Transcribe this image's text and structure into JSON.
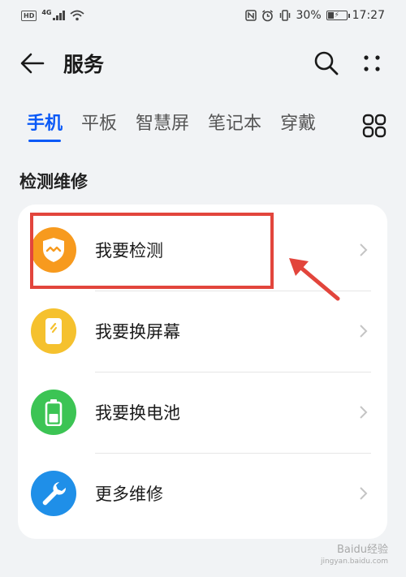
{
  "status_bar": {
    "left": {
      "hd": "HD",
      "network": "4G"
    },
    "battery_percent": "30%",
    "battery_level": 0.3,
    "time": "17:27"
  },
  "header": {
    "title": "服务",
    "icons": [
      "back-arrow-icon",
      "search-icon",
      "more-dots-icon"
    ]
  },
  "tabs": [
    {
      "label": "手机",
      "active": true
    },
    {
      "label": "平板",
      "active": false
    },
    {
      "label": "智慧屏",
      "active": false
    },
    {
      "label": "笔记本",
      "active": false
    },
    {
      "label": "穿戴",
      "active": false
    }
  ],
  "section": {
    "title": "检测维修",
    "items": [
      {
        "label": "我要检测",
        "icon": "shield-icon",
        "color": "#f79a1e"
      },
      {
        "label": "我要换屏幕",
        "icon": "phone-screen-icon",
        "color": "#f5c12e"
      },
      {
        "label": "我要换电池",
        "icon": "battery-icon",
        "color": "#3cc454"
      },
      {
        "label": "更多维修",
        "icon": "wrench-icon",
        "color": "#1f8fe8"
      }
    ]
  },
  "colors": {
    "accent": "#0a59f7",
    "annotation": "#e2453c",
    "background": "#f1f3f5"
  },
  "watermark": {
    "text": "Baidu经验",
    "sub": "jingyan.baidu.com"
  }
}
